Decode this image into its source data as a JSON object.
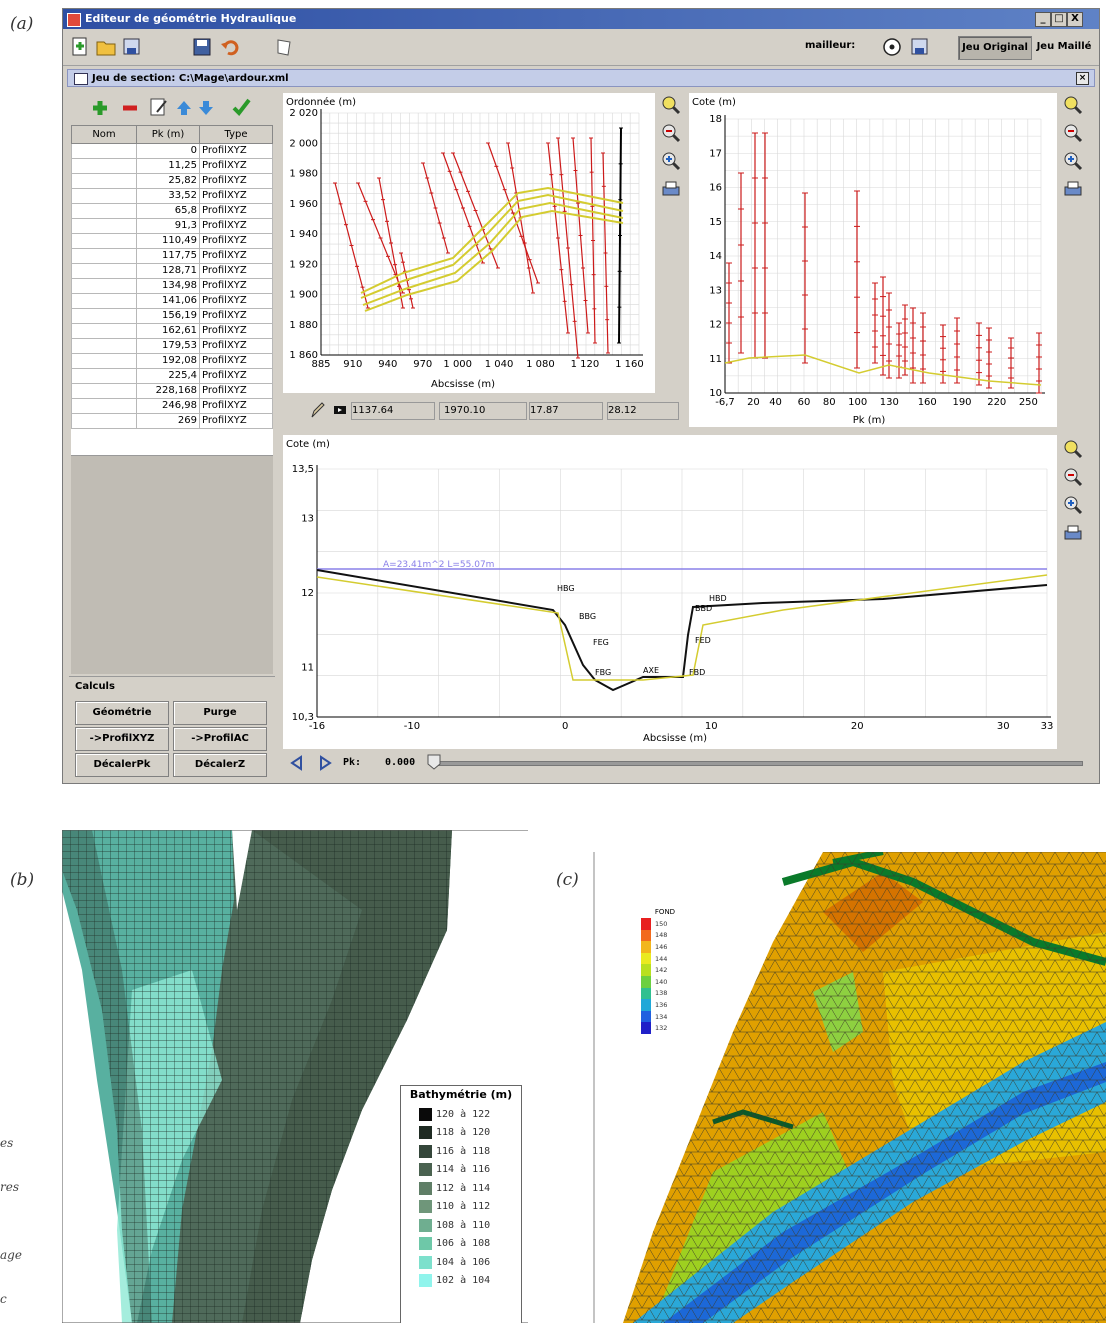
{
  "labels": {
    "a": "(a)",
    "b": "(b)",
    "c": "(c)"
  },
  "side_notes": [
    "es",
    "res",
    "age",
    "c"
  ],
  "window": {
    "title": "Editeur de géométrie Hydraulique",
    "min": "_",
    "max": "□",
    "close": "X"
  },
  "toolbar": {
    "mailleur_label": "mailleur:",
    "tab_original": "Jeu Original",
    "tab_maille": "Jeu Maillé"
  },
  "section": {
    "title": "Jeu de section: C:\\Mage\\ardour.xml"
  },
  "table": {
    "headers": [
      "Nom",
      "Pk (m)",
      "Type"
    ],
    "rows": [
      [
        "",
        "0",
        "ProfilXYZ"
      ],
      [
        "",
        "11,25",
        "ProfilXYZ"
      ],
      [
        "",
        "25,82",
        "ProfilXYZ"
      ],
      [
        "",
        "33,52",
        "ProfilXYZ"
      ],
      [
        "",
        "65,8",
        "ProfilXYZ"
      ],
      [
        "",
        "91,3",
        "ProfilXYZ"
      ],
      [
        "",
        "110,49",
        "ProfilXYZ"
      ],
      [
        "",
        "117,75",
        "ProfilXYZ"
      ],
      [
        "",
        "128,71",
        "ProfilXYZ"
      ],
      [
        "",
        "134,98",
        "ProfilXYZ"
      ],
      [
        "",
        "141,06",
        "ProfilXYZ"
      ],
      [
        "",
        "156,19",
        "ProfilXYZ"
      ],
      [
        "",
        "162,61",
        "ProfilXYZ"
      ],
      [
        "",
        "179,53",
        "ProfilXYZ"
      ],
      [
        "",
        "192,08",
        "ProfilXYZ"
      ],
      [
        "",
        "225,4",
        "ProfilXYZ"
      ],
      [
        "",
        "228,168",
        "ProfilXYZ"
      ],
      [
        "",
        "246,98",
        "ProfilXYZ"
      ],
      [
        "",
        "269",
        "ProfilXYZ"
      ]
    ]
  },
  "calculs": {
    "title": "Calculs",
    "buttons": [
      "Géométrie",
      "Purge",
      "->ProfilXYZ",
      "->ProfilAC",
      "DécalerPk",
      "DécalerZ"
    ]
  },
  "plan": {
    "ylabel": "Ordonnée (m)",
    "xlabel": "Abcsisse (m)",
    "yticks": [
      "2 020",
      "2 000",
      "1 980",
      "1 960",
      "1 940",
      "1 920",
      "1 900",
      "1 880",
      "1 860"
    ],
    "xticks": [
      "885",
      "910",
      "940",
      "970",
      "1 000",
      "1 040",
      "1 080",
      "1 120",
      "1 160"
    ],
    "readout": [
      "1137.64",
      "1970.10",
      "17.87",
      "28.12"
    ]
  },
  "long": {
    "ylabel": "Cote (m)",
    "xlabel": "Pk (m)",
    "yticks": [
      "18",
      "17",
      "16",
      "15",
      "14",
      "13",
      "12",
      "11",
      "10"
    ],
    "xticks": [
      "-6,7",
      "20",
      "40",
      "60",
      "80",
      "100",
      "130",
      "160",
      "190",
      "220",
      "250"
    ]
  },
  "cross": {
    "ylabel": "Cote (m)",
    "xlabel": "Abcsisse (m)",
    "yticks": [
      "13,5",
      "13",
      "12",
      "11",
      "10,3"
    ],
    "xticks": [
      "-16",
      "-10",
      "0",
      "10",
      "20",
      "30",
      "33"
    ],
    "annotation": "A=23.41m^2 L=55.07m",
    "points": [
      "HBG",
      "BBG",
      "FEG",
      "FBG",
      "AXE",
      "FBD",
      "FED",
      "BBD",
      "HBD"
    ],
    "pk_label": "Pk:",
    "pk_value": "0.000"
  },
  "bathy": {
    "title": "Bathymétrie (m)",
    "entries": [
      "120 à 122",
      "118 à 120",
      "116 à 118",
      "114 à 116",
      "112 à 114",
      "110 à 112",
      "108 à 110",
      "106 à 108",
      "104 à 106",
      "102 à 104"
    ],
    "colors": [
      "#0a0a0a",
      "#1f2b23",
      "#34463a",
      "#4a6250",
      "#5f7e66",
      "#6f967a",
      "#6fae90",
      "#6ec8a8",
      "#7de0cc",
      "#90f4ec"
    ]
  },
  "fond": {
    "title": "FOND",
    "entries": [
      "150",
      "148",
      "146",
      "144",
      "142",
      "140",
      "138",
      "136",
      "134",
      "132"
    ],
    "colors": [
      "#e81f1f",
      "#f26a1c",
      "#f2b61c",
      "#eaea20",
      "#b8e020",
      "#6cd040",
      "#30c090",
      "#20a8d8",
      "#2060e0",
      "#2020c8"
    ]
  }
}
